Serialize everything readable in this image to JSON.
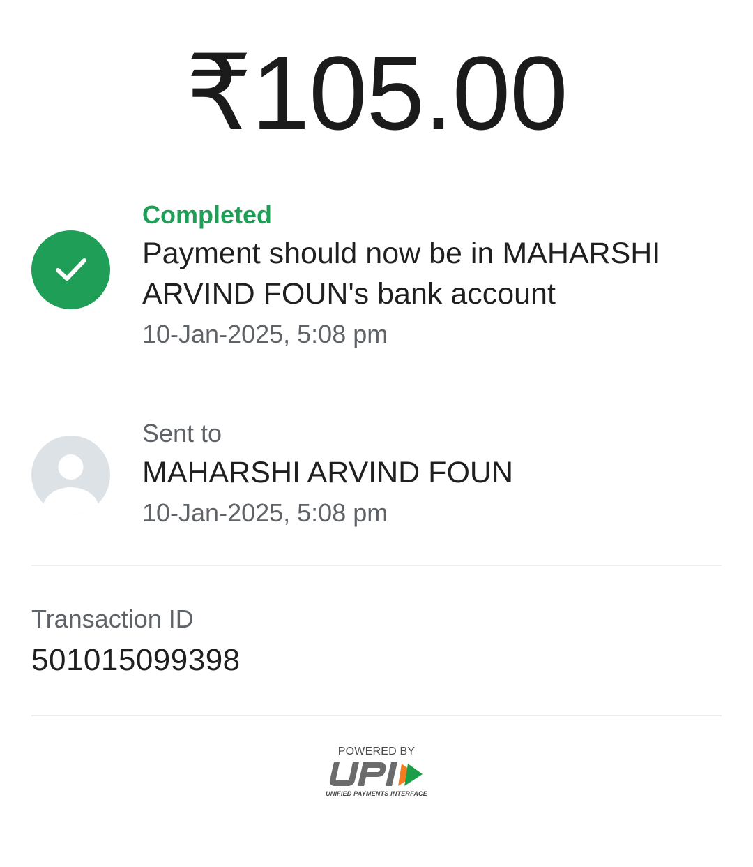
{
  "payment": {
    "amount": "₹105.00"
  },
  "status": {
    "label": "Completed",
    "message": "Payment should now be in MAHARSHI ARVIND FOUN's bank account",
    "timestamp": "10-Jan-2025, 5:08 pm",
    "icon": "check-icon",
    "color": "#1e9e57"
  },
  "recipient": {
    "label": "Sent to",
    "name": "MAHARSHI ARVIND FOUN",
    "timestamp": "10-Jan-2025, 5:08 pm",
    "icon": "person-icon"
  },
  "transaction": {
    "label": "Transaction ID",
    "id": "501015099398"
  },
  "footer": {
    "powered_by": "POWERED BY",
    "logo_text": "UPI",
    "logo_subtitle": "UNIFIED PAYMENTS INTERFACE",
    "colors": {
      "orange": "#f47c20",
      "green": "#1b9e47",
      "gray": "#6b6b6b"
    }
  }
}
